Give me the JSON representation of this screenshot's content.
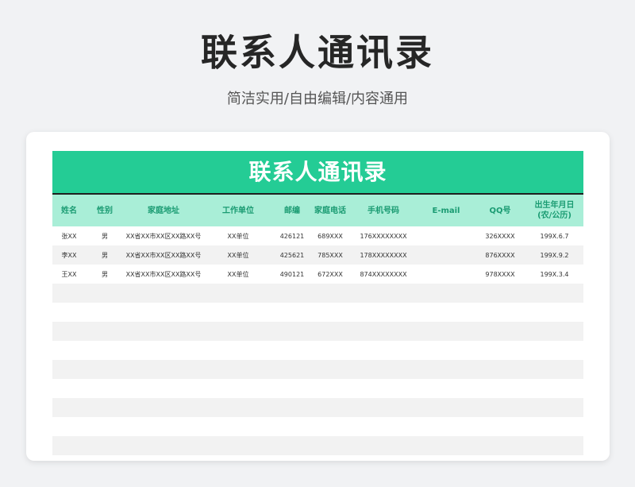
{
  "page": {
    "title": "联系人通讯录",
    "subtitle": "简洁实用/自由编辑/内容通用"
  },
  "sheet": {
    "banner": "联系人通讯录",
    "columns": [
      "姓名",
      "性别",
      "家庭地址",
      "工作单位",
      "邮编",
      "家庭电话",
      "手机号码",
      "E-mail",
      "QQ号",
      "出生年月日",
      "(农/公历)"
    ],
    "rows": [
      [
        "张XX",
        "男",
        "XX省XX市XX区XX路XX号",
        "XX单位",
        "426121",
        "689XXX",
        "176XXXXXXXX",
        "",
        "326XXXX",
        "199X.6.7"
      ],
      [
        "李XX",
        "男",
        "XX省XX市XX区XX路XX号",
        "XX单位",
        "425621",
        "785XXX",
        "178XXXXXXXX",
        "",
        "876XXXX",
        "199X.9.2"
      ],
      [
        "王XX",
        "男",
        "XX省XX市XX区XX路XX号",
        "XX单位",
        "490121",
        "672XXX",
        "874XXXXXXXX",
        "",
        "978XXXX",
        "199X.3.4"
      ]
    ],
    "empty_row_count": 9
  },
  "colors": {
    "banner": "#24cc95",
    "header_bg": "#a9eed7",
    "header_text": "#1a9b72",
    "stripe": "#f2f2f2"
  }
}
